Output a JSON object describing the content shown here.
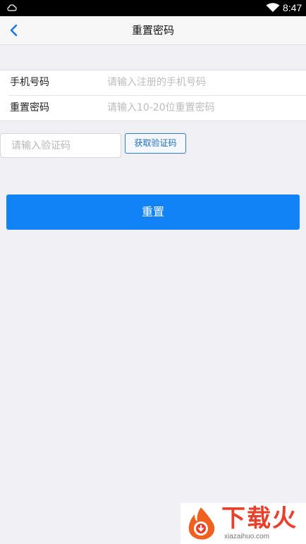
{
  "status_bar": {
    "time": "8:47",
    "left_icon": "notification-icon",
    "wifi_icon": "wifi-icon"
  },
  "nav": {
    "title": "重置密码",
    "back_icon": "chevron-left-icon"
  },
  "form": {
    "phone_label": "手机号码",
    "phone_placeholder": "请输入注册的手机号码",
    "password_label": "重置密码",
    "password_placeholder": "请输入10-20位重置密码"
  },
  "verify": {
    "code_placeholder": "请输入验证码",
    "get_code_label": "获取验证码"
  },
  "actions": {
    "reset_label": "重置"
  },
  "watermark": {
    "brand": "下载火",
    "domain": "xiazaihuo.com"
  },
  "colors": {
    "accent": "#1283f4",
    "background": "#efeff4",
    "placeholder": "#bcbcbc"
  }
}
